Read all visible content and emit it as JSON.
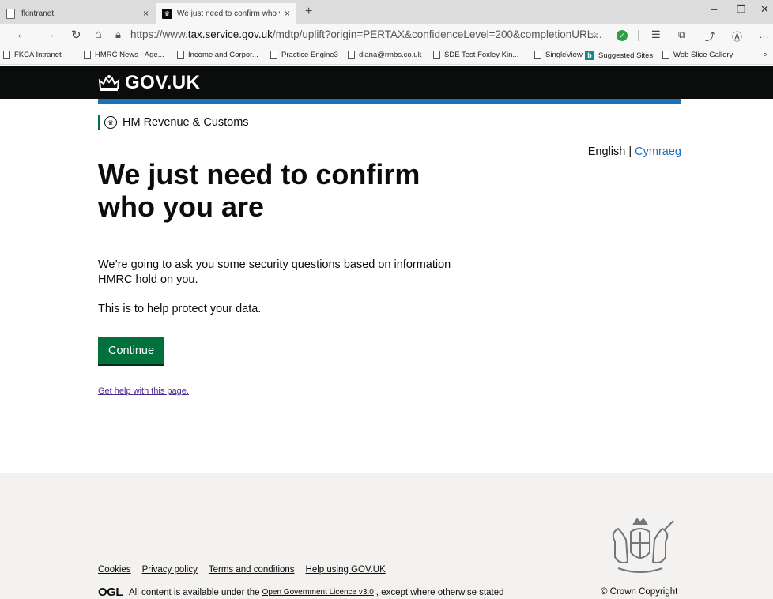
{
  "browser": {
    "tabs": [
      {
        "title": "fkintranet",
        "close": "×"
      },
      {
        "title": "We just need to confirm who yo",
        "close": "×"
      }
    ],
    "new_tab": "+",
    "window_controls": [
      "–",
      "❐",
      "✕"
    ],
    "url_host_prefix": "https://www.",
    "url_host": "tax.service.gov.uk",
    "url_path": "/mdtp/uplift?origin=PERTAX&confidenceLevel=200&completionURL...",
    "favorites": [
      "FKCA Intranet",
      "HMRC News - Age...",
      "Income and Corpor...",
      "Practice Engine3",
      "diana@rmbs.co.uk",
      "SDE Test Foxley Kin...",
      "SingleView",
      "Suggested Sites",
      "Web Slice Gallery"
    ],
    "favorites_more": ">"
  },
  "header": {
    "logo_text": "GOV.UK",
    "department": "HM Revenue & Customs"
  },
  "language": {
    "current": "English",
    "separator": "|",
    "other": "Cymraeg"
  },
  "main": {
    "title": "We just need to confirm who you are",
    "para1": "We’re going to ask you some security questions based on information HMRC hold on you.",
    "para2": "This is to help protect your data.",
    "continue_label": "Continue",
    "help_link": "Get help with this page."
  },
  "footer": {
    "links": [
      "Cookies",
      "Privacy policy",
      "Terms and conditions",
      "Help using GOV.UK"
    ],
    "ogl_logo": "OGL",
    "licence_prefix": "All content is available under the",
    "licence_link": "Open Government Licence v3.0",
    "licence_suffix": ", except where otherwise stated",
    "copyright": "© Crown Copyright"
  },
  "colors": {
    "header_bg": "#0b0c0c",
    "brand_blue": "#1d70b8",
    "button_green": "#00703c",
    "footer_bg": "#f3f2f1",
    "visited_link": "#4c2c92"
  }
}
